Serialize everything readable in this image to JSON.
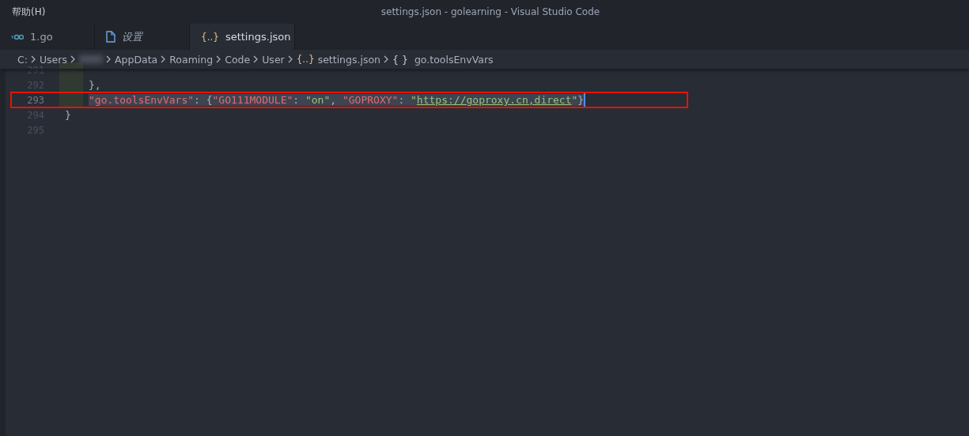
{
  "menu": {
    "label": "帮助(H)"
  },
  "window": {
    "title": "settings.json - golearning - Visual Studio Code"
  },
  "tabs": [
    {
      "label": "1.go",
      "kind": "go",
      "selected": false,
      "italic": false
    },
    {
      "label": "设置",
      "kind": "file",
      "selected": false,
      "italic": true
    },
    {
      "label": "settings.json",
      "kind": "json",
      "icon": "{..}",
      "selected": true,
      "italic": false
    }
  ],
  "breadcrumb": [
    {
      "label": "C:",
      "kind": "text"
    },
    {
      "label": "Users",
      "kind": "text"
    },
    {
      "kind": "redacted"
    },
    {
      "label": "AppData",
      "kind": "text"
    },
    {
      "label": "Roaming",
      "kind": "text"
    },
    {
      "label": "Code",
      "kind": "text"
    },
    {
      "label": "User",
      "kind": "text"
    },
    {
      "label": "settings.json",
      "kind": "json",
      "icon": "{..}"
    },
    {
      "label": "go.toolsEnvVars",
      "kind": "object",
      "icon": "{ }"
    }
  ],
  "lines": [
    {
      "children": [
        {
          "number": "291",
          "highlighted": false
        },
        {
          "number": "292",
          "highlighted": false,
          "tokens": [
            {
              "text": "},",
              "kind": "punct"
            }
          ]
        },
        {
          "number": "293",
          "highlighted": true,
          "tokens": [
            {
              "text": "\"go.toolsEnvVars\"",
              "kind": "key"
            },
            {
              "text": ": {",
              "kind": "punct"
            },
            {
              "text": "\"GO111MODULE\"",
              "kind": "key"
            },
            {
              "text": ": ",
              "kind": "punct"
            },
            {
              "text": "\"on\"",
              "kind": "string"
            },
            {
              "text": ", ",
              "kind": "punct"
            },
            {
              "text": "\"GOPROXY\"",
              "kind": "key"
            },
            {
              "text": ": ",
              "kind": "punct"
            },
            {
              "text": "\"",
              "kind": "string"
            },
            {
              "text": "https://goproxy.cn,direct",
              "kind": "link"
            },
            {
              "text": "\"",
              "kind": "string"
            },
            {
              "text": "}",
              "kind": "punct"
            }
          ]
        }
      ]
    },
    {
      "number": "294",
      "highlighted": false,
      "tokens": [
        {
          "text": "}",
          "kind": "punct"
        }
      ]
    },
    {
      "number": "295",
      "highlighted": false
    }
  ]
}
